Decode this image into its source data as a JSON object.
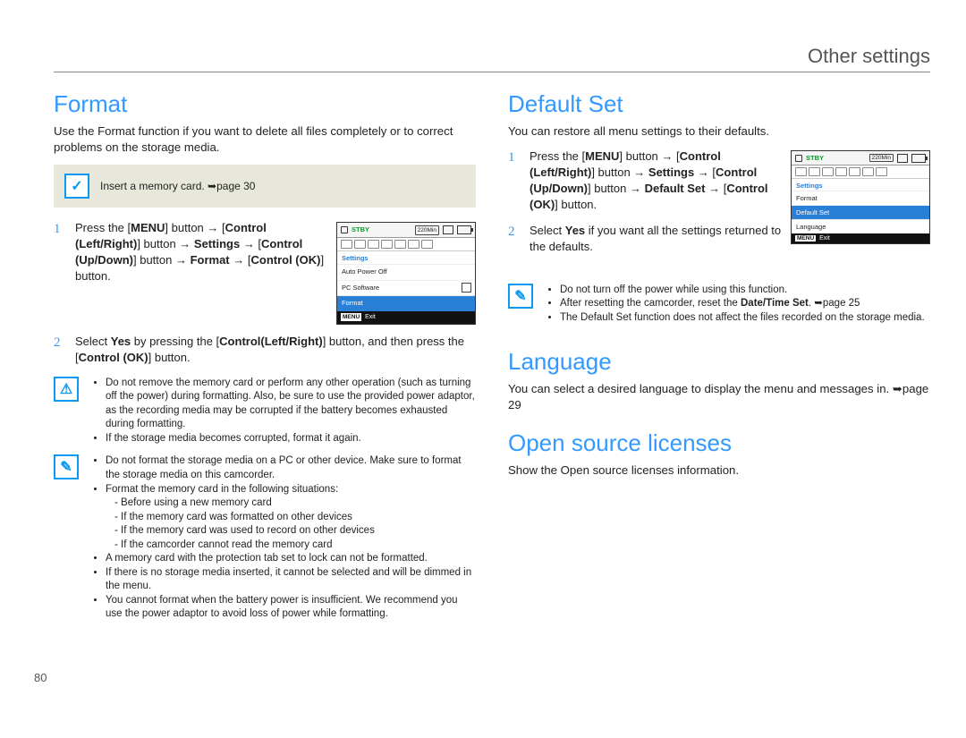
{
  "header": {
    "title": "Other settings"
  },
  "pageNumber": "80",
  "left": {
    "title": "Format",
    "intro": "Use the Format function if you want to delete all files completely or to correct problems on the storage media.",
    "callout": "Insert a memory card. ➥page 30",
    "step1": {
      "pre": "Press the [",
      "menu": "MENU",
      "mid1": "] button → [",
      "clr": "Control (Left/Right)",
      "mid2": "] button → ",
      "settings": "Settings",
      "mid3": " → [",
      "cud": "Control (Up/Down)",
      "mid4": "] button → ",
      "format": "Format",
      "mid5": " → [",
      "cok": "Control (OK)",
      "end": "] button."
    },
    "step2": {
      "pre": "Select ",
      "yes": "Yes",
      "mid1": " by pressing the [",
      "clr": "Control(Left/Right)",
      "mid2": "] button, and then press the [",
      "cok": "Control (OK)",
      "end": "] button."
    },
    "lcd": {
      "stby": "STBY",
      "time": "220Min",
      "hdr": "Settings",
      "i1": "Auto Power Off",
      "i2": "PC Software",
      "i3": "Format",
      "menu": "MENU",
      "exit": "Exit"
    },
    "warn": {
      "b1": "Do not remove the memory card or perform any other operation (such as turning off the power) during formatting. Also, be sure to use the provided power adaptor, as the recording media may be corrupted if the battery becomes exhausted during formatting.",
      "b2": "If the storage media becomes corrupted, format it again."
    },
    "notes": {
      "b1": "Do not format the storage media on a PC or other device. Make sure to format the storage media on this camcorder.",
      "b2": "Format the memory card in the following situations:",
      "b2a": "Before using a new memory card",
      "b2b": "If the memory card was formatted on other devices",
      "b2c": "If the memory card was used to record on other devices",
      "b2d": "If the camcorder cannot read the memory card",
      "b3": "A memory card with the protection tab set to lock can not be formatted.",
      "b4": "If there is no storage media inserted, it cannot be selected and will be dimmed in the menu.",
      "b5": "You cannot format when the battery power is insufficient. We recommend you use the power adaptor to avoid loss of power while formatting."
    }
  },
  "right": {
    "defaultSet": {
      "title": "Default Set",
      "intro": "You can restore all menu settings to their defaults.",
      "step1": {
        "pre": "Press the [",
        "menu": "MENU",
        "mid1": "] button → [",
        "clr": "Control (Left/Right)",
        "mid2": "] button → ",
        "settings": "Settings",
        "mid3": " → [",
        "cud": "Control (Up/Down)",
        "mid4": "] button → ",
        "ds": "Default Set",
        "mid5": " → [",
        "cok": "Control (OK)",
        "end": "] button."
      },
      "step2": {
        "pre": "Select ",
        "yes": "Yes",
        "end": " if you want all the settings returned to the defaults."
      },
      "lcd": {
        "stby": "STBY",
        "time": "220Min",
        "hdr": "Settings",
        "i1": "Format",
        "i2": "Default Set",
        "i3": "Language",
        "menu": "MENU",
        "exit": "Exit"
      },
      "notes": {
        "b1": "Do not turn off the power while using this function.",
        "b2a": "After resetting the camcorder, reset the ",
        "b2b": "Date/Time Set",
        "b2c": ". ➥page 25",
        "b3": "The Default Set function does not affect the files recorded on the storage media."
      }
    },
    "language": {
      "title": "Language",
      "intro": "You can select a desired language to display the menu and messages in. ➥page 29"
    },
    "osl": {
      "title": "Open source licenses",
      "intro": "Show the Open source licenses information."
    }
  }
}
